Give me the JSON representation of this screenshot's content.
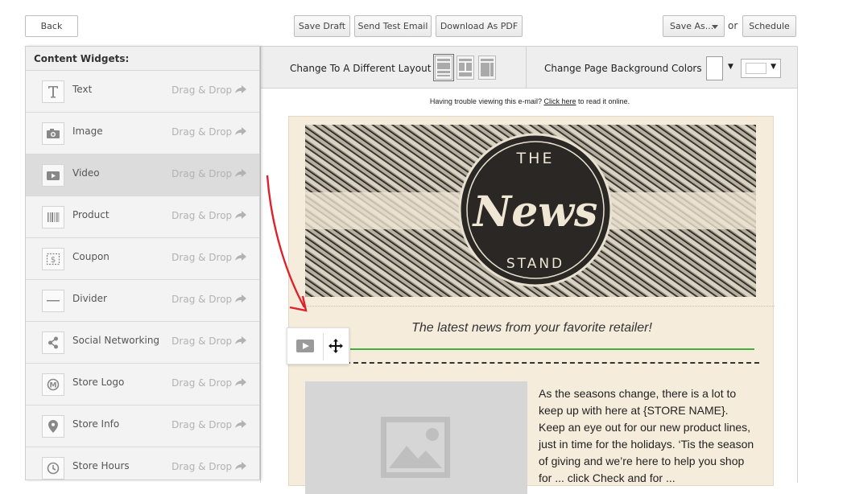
{
  "header": {
    "back_label": "Back",
    "save_draft_label": "Save Draft",
    "send_test_label": "Send Test Email",
    "download_pdf_label": "Download As PDF",
    "save_as_label": "Save As...",
    "or_text": "or",
    "schedule_label": "Schedule"
  },
  "sidebar": {
    "title": "Content Widgets:",
    "drag_label": "Drag & Drop",
    "items": [
      {
        "label": "Text",
        "icon": "text-icon"
      },
      {
        "label": "Image",
        "icon": "camera-icon"
      },
      {
        "label": "Video",
        "icon": "video-icon"
      },
      {
        "label": "Product",
        "icon": "barcode-icon"
      },
      {
        "label": "Coupon",
        "icon": "coupon-icon"
      },
      {
        "label": "Divider",
        "icon": "divider-icon"
      },
      {
        "label": "Social Networking",
        "icon": "share-icon"
      },
      {
        "label": "Store Logo",
        "icon": "logo-icon"
      },
      {
        "label": "Store Info",
        "icon": "map-pin-icon"
      },
      {
        "label": "Store Hours",
        "icon": "clock-icon"
      }
    ]
  },
  "toolbar": {
    "layout_label": "Change To A Different Layout",
    "background_label": "Change Page Background Colors",
    "caret": "▼"
  },
  "email": {
    "trouble_text": "Having trouble viewing this e-mail?",
    "click_here": "Click here",
    "read_online": "to read it online.",
    "banner_the": "THE",
    "banner_news": "News",
    "banner_stand": "STAND",
    "tagline": "The latest news from your favorite retailer!",
    "body_text": "As the seasons change, there is a lot to keep up with here at {STORE NAME}. Keep an eye out for our new product lines, just in time for the holidays. ‘Tis the season of giving and we’re here to help you shop for ... click Check and for ..."
  },
  "colors": {
    "accent_green": "#3fae3f",
    "email_bg": "#f5ecdc",
    "annotation_red": "#e0202a"
  }
}
